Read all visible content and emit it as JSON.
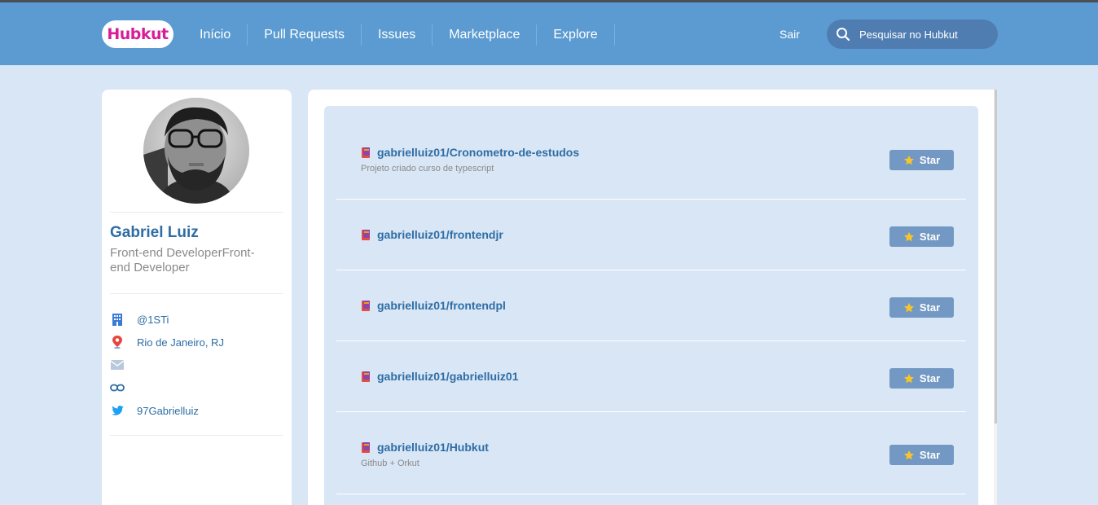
{
  "header": {
    "logo": "Hubkut",
    "nav": [
      "Início",
      "Pull Requests",
      "Issues",
      "Marketplace",
      "Explore"
    ],
    "logout": "Sair",
    "search_placeholder": "Pesquisar no Hubkut"
  },
  "profile": {
    "name": "Gabriel Luiz",
    "bio": "Front-end DeveloperFront-end Developer",
    "items": [
      {
        "icon": "building-icon",
        "text": "@1STi"
      },
      {
        "icon": "location-pin-icon",
        "text": "Rio de Janeiro, RJ"
      },
      {
        "icon": "mail-icon",
        "text": ""
      },
      {
        "icon": "link-icon",
        "text": ""
      },
      {
        "icon": "twitter-icon",
        "text": "97Gabrielluiz"
      }
    ]
  },
  "repos": [
    {
      "name": "gabrielluiz01/Cronometro-de-estudos",
      "description": "Projeto criado curso de typescript",
      "star_label": "Star"
    },
    {
      "name": "gabrielluiz01/frontendjr",
      "description": "",
      "star_label": "Star"
    },
    {
      "name": "gabrielluiz01/frontendpl",
      "description": "",
      "star_label": "Star"
    },
    {
      "name": "gabrielluiz01/gabrielluiz01",
      "description": "",
      "star_label": "Star"
    },
    {
      "name": "gabrielluiz01/Hubkut",
      "description": "Github + Orkut",
      "star_label": "Star"
    }
  ],
  "colors": {
    "header": "#5b9bd1",
    "background": "#d9e6f6",
    "link": "#2e6da4",
    "logo": "#d81d99",
    "star_button": "#7298c3"
  }
}
